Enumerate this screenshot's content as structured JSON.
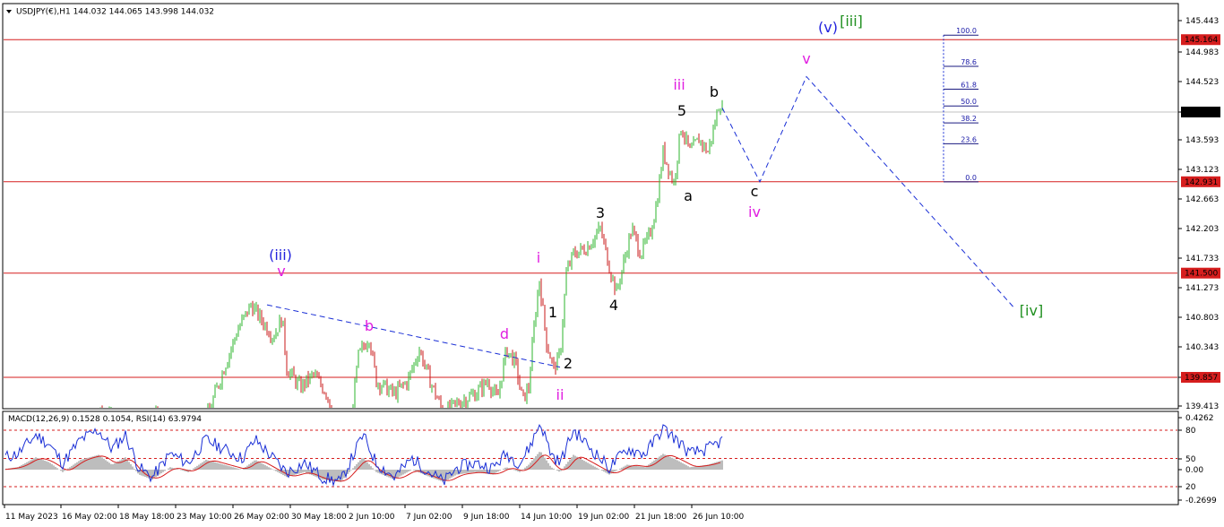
{
  "header": {
    "symbol_text": "USDJPY(€),H1  144.032 144.065 143.998 144.032"
  },
  "indicator_header": "MACD(12,26,9) 0.1528 0.1054, RSI(14) 63.9794",
  "colors": {
    "up": "#2db52d",
    "down": "#c91a1a",
    "level": "#d61e1e",
    "trend": "#1a2fd6",
    "wave_blue": "#2222dd",
    "wave_magenta": "#e01ee0",
    "wave_black": "#000000",
    "wave_green": "#1f8f1f",
    "macd_hist": "#bdbdbd",
    "macd_signal": "#d61e1e",
    "rsi": "#1a2fd6"
  },
  "chart_data": [
    {
      "type": "candlestick",
      "instrument": "USDJPY",
      "timeframe": "H1",
      "ylim": [
        139.3,
        145.55
      ],
      "y_ticks": [
        "145.443",
        "144.983",
        "144.523",
        "144.032",
        "143.593",
        "143.123",
        "142.663",
        "142.203",
        "141.733",
        "141.273",
        "140.803",
        "140.343",
        "139.857",
        "139.413"
      ],
      "x_ticks": [
        "11 May 2023",
        "16 May 02:00",
        "18 May 18:00",
        "23 May 10:00",
        "26 May 02:00",
        "30 May 18:00",
        "2 Jun 10:00",
        "7 Jun 02:00",
        "9 Jun 18:00",
        "14 Jun 10:00",
        "19 Jun 02:00",
        "21 Jun 18:00",
        "26 Jun 10:00"
      ],
      "levels": [
        {
          "value": 145.164,
          "label": "145.164"
        },
        {
          "value": 142.931,
          "label": "142.931"
        },
        {
          "value": 141.5,
          "label": "141.500"
        },
        {
          "value": 139.857,
          "label": "139.857"
        }
      ],
      "current_price": {
        "value": 144.032,
        "label": "144.032"
      },
      "price_anchors": [
        [
          0,
          139.0
        ],
        [
          35,
          139.2
        ],
        [
          70,
          139.1
        ],
        [
          100,
          139.2
        ],
        [
          120,
          139.3
        ],
        [
          140,
          139.0
        ],
        [
          170,
          139.3
        ],
        [
          200,
          139.0
        ],
        [
          230,
          139.2
        ],
        [
          250,
          140.0
        ],
        [
          265,
          140.6
        ],
        [
          280,
          141.0
        ],
        [
          295,
          140.7
        ],
        [
          305,
          140.5
        ],
        [
          315,
          140.8
        ],
        [
          320,
          140.0
        ],
        [
          335,
          139.7
        ],
        [
          350,
          139.9
        ],
        [
          365,
          139.6
        ],
        [
          375,
          139.1
        ],
        [
          390,
          139.0
        ],
        [
          400,
          140.2
        ],
        [
          412,
          140.5
        ],
        [
          420,
          139.8
        ],
        [
          440,
          139.6
        ],
        [
          455,
          139.8
        ],
        [
          468,
          140.3
        ],
        [
          480,
          139.8
        ],
        [
          495,
          139.3
        ],
        [
          515,
          139.5
        ],
        [
          530,
          139.6
        ],
        [
          545,
          139.8
        ],
        [
          555,
          139.5
        ],
        [
          565,
          140.3
        ],
        [
          575,
          140.1
        ],
        [
          583,
          139.5
        ],
        [
          590,
          139.7
        ],
        [
          597,
          140.8
        ],
        [
          602,
          141.4
        ],
        [
          610,
          140.4
        ],
        [
          618,
          140.0
        ],
        [
          625,
          140.2
        ],
        [
          632,
          141.5
        ],
        [
          640,
          141.8
        ],
        [
          655,
          141.9
        ],
        [
          670,
          142.2
        ],
        [
          680,
          141.6
        ],
        [
          688,
          141.2
        ],
        [
          695,
          141.6
        ],
        [
          705,
          142.2
        ],
        [
          715,
          141.8
        ],
        [
          725,
          142.1
        ],
        [
          733,
          142.6
        ],
        [
          740,
          143.4
        ],
        [
          752,
          142.9
        ],
        [
          760,
          143.8
        ],
        [
          770,
          143.4
        ],
        [
          780,
          143.6
        ],
        [
          790,
          143.4
        ],
        [
          797,
          143.8
        ],
        [
          803,
          144.2
        ],
        [
          808,
          144.0
        ]
      ],
      "projection_path": [
        {
          "x": "26 Jun 10:00",
          "value": 144.1
        },
        {
          "point": "c",
          "value": 142.93
        },
        {
          "point": "v",
          "value": 144.6
        },
        {
          "point": "[iv]",
          "value": 140.95
        }
      ],
      "trendline": {
        "from_value": 141.0,
        "to_value": 140.02
      },
      "fibonacci": {
        "levels": [
          {
            "ratio": "100.0",
            "value": 145.23
          },
          {
            "ratio": "78.6",
            "value": 144.76
          },
          {
            "ratio": "61.8",
            "value": 144.4
          },
          {
            "ratio": "50.0",
            "value": 144.13
          },
          {
            "ratio": "38.2",
            "value": 143.86
          },
          {
            "ratio": "23.6",
            "value": 143.53
          },
          {
            "ratio": "0.0",
            "value": 142.93
          }
        ]
      },
      "wave_labels": [
        {
          "text": "(v)",
          "color_key": "wave_blue"
        },
        {
          "text": "[iii]",
          "color_key": "wave_green"
        },
        {
          "text": "v",
          "color_key": "wave_magenta"
        },
        {
          "text": "iii",
          "color_key": "wave_magenta"
        },
        {
          "text": "b",
          "color_key": "wave_black"
        },
        {
          "text": "5",
          "color_key": "wave_black"
        },
        {
          "text": "a",
          "color_key": "wave_black"
        },
        {
          "text": "c",
          "color_key": "wave_black"
        },
        {
          "text": "iv",
          "color_key": "wave_magenta"
        },
        {
          "text": "3",
          "color_key": "wave_black"
        },
        {
          "text": "(iii)",
          "color_key": "wave_blue"
        },
        {
          "text": "v",
          "color_key": "wave_magenta"
        },
        {
          "text": "i",
          "color_key": "wave_magenta"
        },
        {
          "text": "4",
          "color_key": "wave_black"
        },
        {
          "text": "[iv]",
          "color_key": "wave_green"
        },
        {
          "text": "b",
          "color_key": "wave_magenta"
        },
        {
          "text": "d",
          "color_key": "wave_magenta"
        },
        {
          "text": "1",
          "color_key": "wave_black"
        },
        {
          "text": "2",
          "color_key": "wave_black"
        },
        {
          "text": "ii",
          "color_key": "wave_magenta"
        }
      ]
    },
    {
      "type": "line",
      "name": "MACD(12,26,9), RSI(14)",
      "values": {
        "macd_main": 0.1528,
        "macd_signal": 0.1054,
        "rsi": 63.9794
      },
      "y_ticks": [
        "0.4262",
        "80",
        "50",
        "0.00",
        "20",
        "-0.2699"
      ],
      "rsi_levels": [
        80,
        50,
        20
      ],
      "rsi_anchors": [
        [
          0,
          50
        ],
        [
          20,
          55
        ],
        [
          40,
          75
        ],
        [
          55,
          65
        ],
        [
          70,
          45
        ],
        [
          90,
          70
        ],
        [
          110,
          80
        ],
        [
          125,
          60
        ],
        [
          140,
          75
        ],
        [
          155,
          40
        ],
        [
          170,
          30
        ],
        [
          190,
          55
        ],
        [
          210,
          45
        ],
        [
          230,
          70
        ],
        [
          250,
          60
        ],
        [
          270,
          50
        ],
        [
          285,
          70
        ],
        [
          300,
          55
        ],
        [
          320,
          35
        ],
        [
          340,
          45
        ],
        [
          360,
          30
        ],
        [
          380,
          25
        ],
        [
          395,
          55
        ],
        [
          405,
          75
        ],
        [
          420,
          45
        ],
        [
          440,
          30
        ],
        [
          460,
          50
        ],
        [
          480,
          35
        ],
        [
          495,
          25
        ],
        [
          510,
          40
        ],
        [
          530,
          45
        ],
        [
          550,
          40
        ],
        [
          565,
          55
        ],
        [
          580,
          45
        ],
        [
          590,
          60
        ],
        [
          603,
          88
        ],
        [
          615,
          55
        ],
        [
          625,
          45
        ],
        [
          640,
          80
        ],
        [
          660,
          60
        ],
        [
          680,
          40
        ],
        [
          700,
          60
        ],
        [
          720,
          55
        ],
        [
          740,
          82
        ],
        [
          755,
          70
        ],
        [
          770,
          55
        ],
        [
          790,
          60
        ],
        [
          808,
          70
        ]
      ]
    }
  ]
}
